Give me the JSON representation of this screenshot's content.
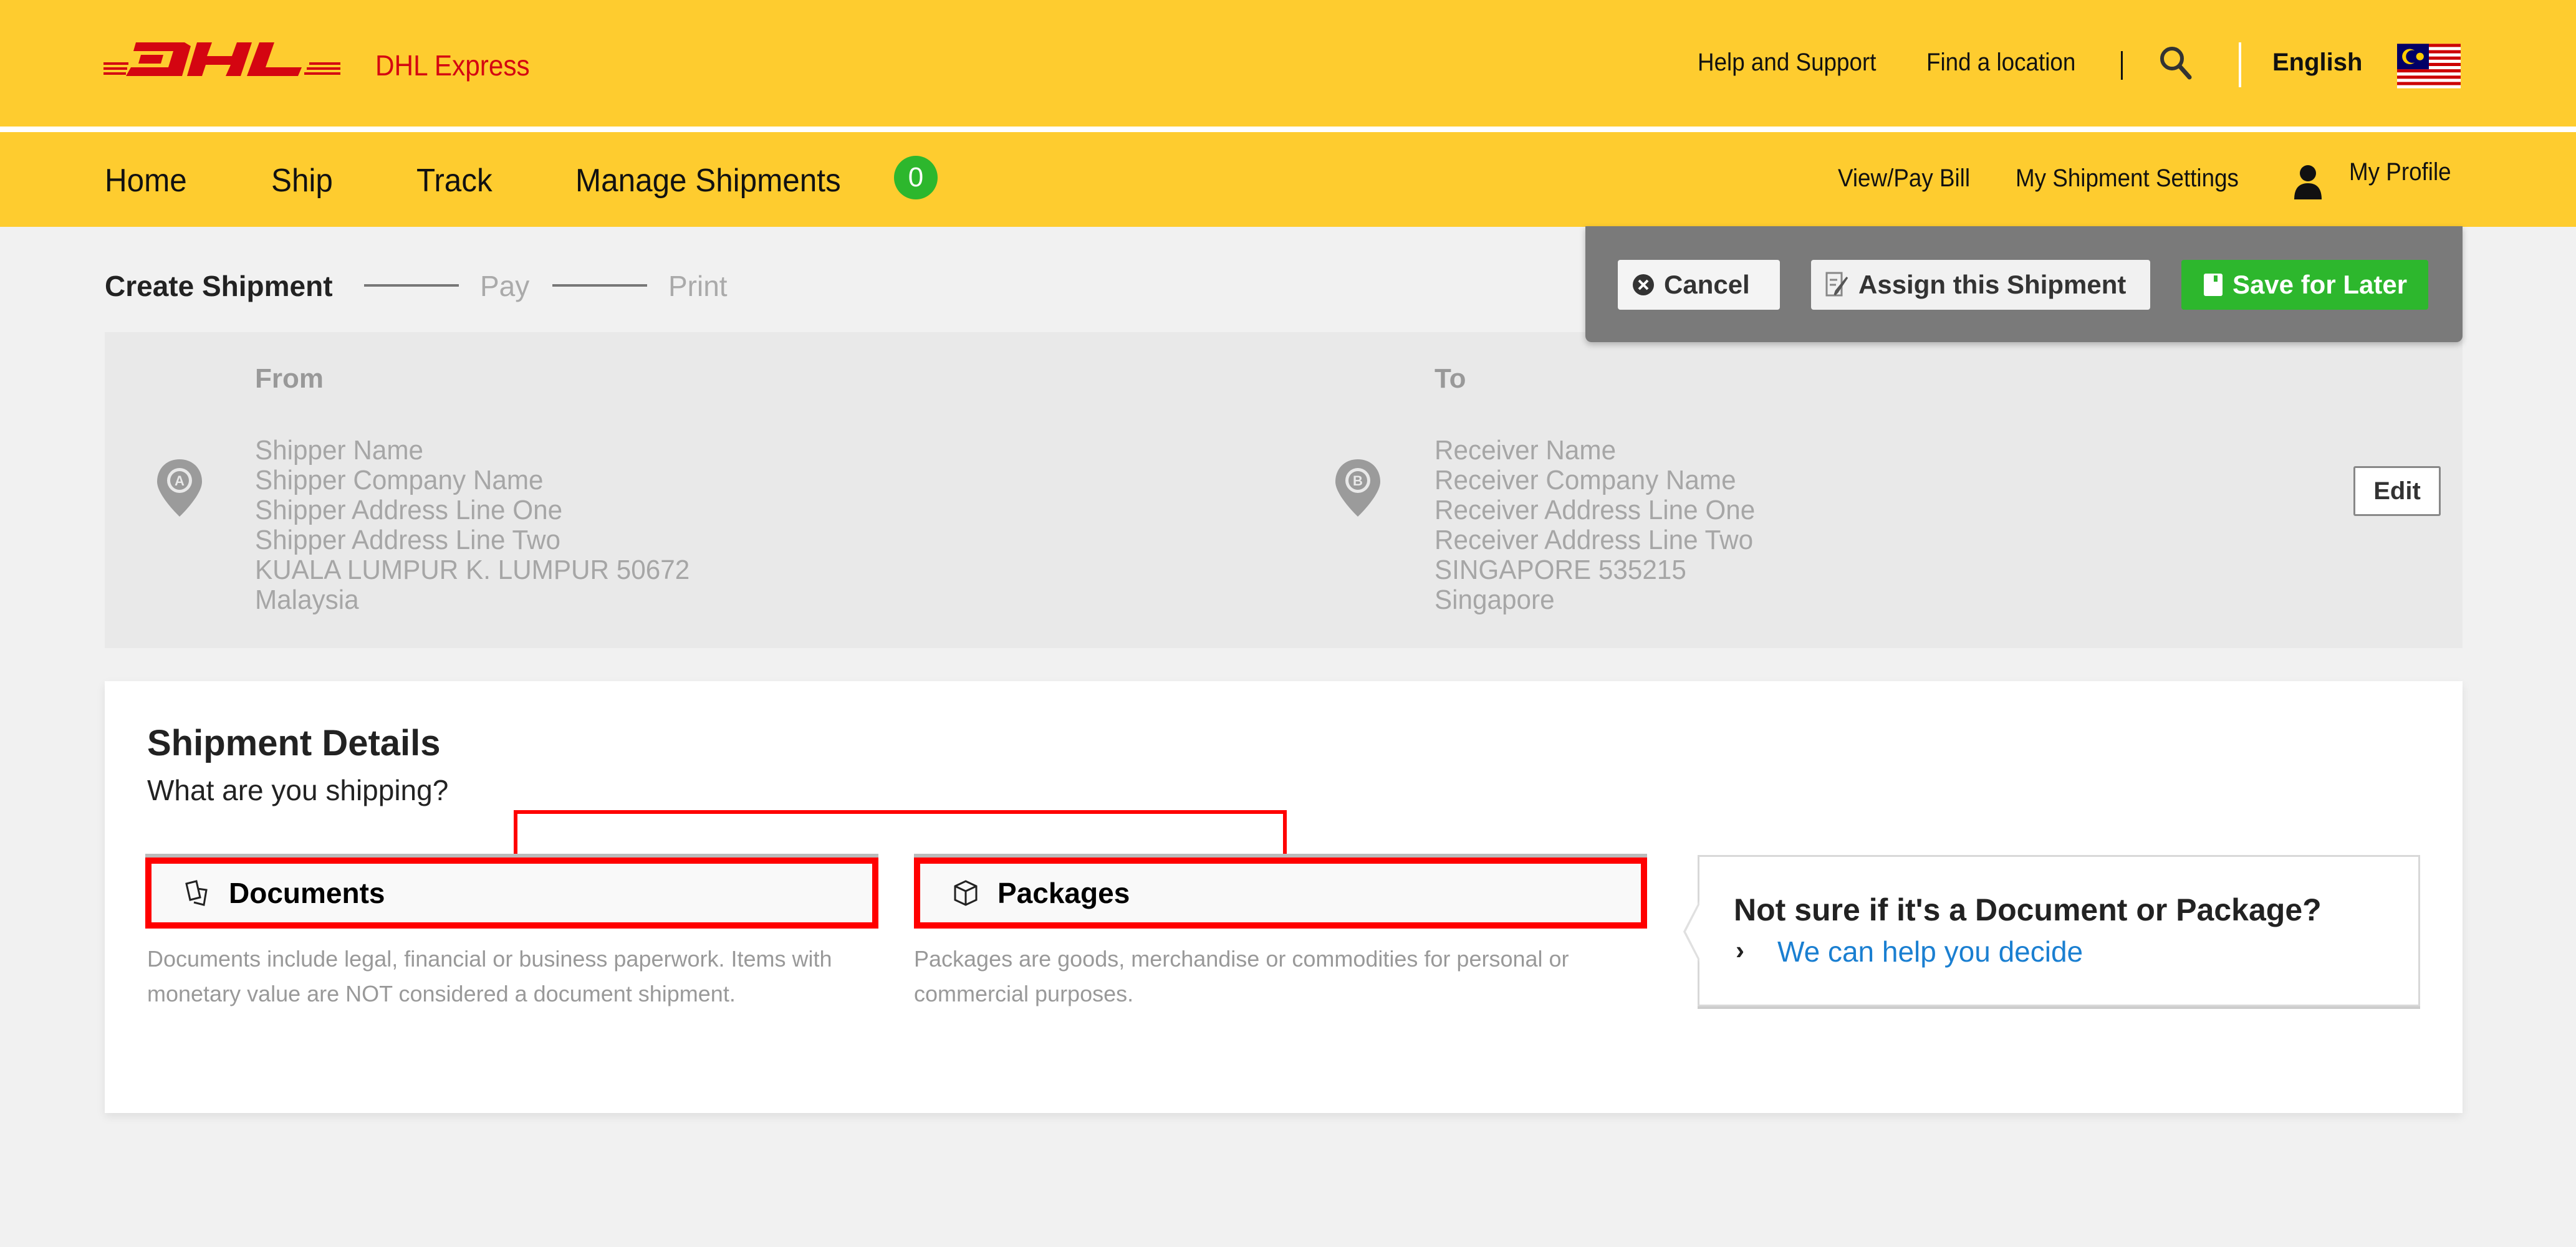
{
  "header": {
    "brand_name": "DHL Express",
    "logo_text": "DHL",
    "links": {
      "help": "Help and Support",
      "find_location": "Find a location"
    },
    "language": "English",
    "flag": "malaysia-flag",
    "icons": {
      "search": "search-icon"
    }
  },
  "nav": {
    "items": [
      {
        "label": "Home"
      },
      {
        "label": "Ship"
      },
      {
        "label": "Track"
      },
      {
        "label": "Manage Shipments"
      }
    ],
    "manage_badge_count": "0",
    "right": {
      "view_pay_bill": "View/Pay Bill",
      "shipment_settings": "My Shipment Settings",
      "profile": "My Profile"
    }
  },
  "steps": {
    "current": "Create Shipment",
    "pay": "Pay",
    "print": "Print"
  },
  "actions": {
    "cancel": "Cancel",
    "assign": "Assign this Shipment",
    "save": "Save for Later"
  },
  "addresses": {
    "from": {
      "label": "From",
      "pin": "A",
      "lines": [
        "Shipper Name",
        "Shipper Company Name",
        "Shipper Address Line One",
        "Shipper Address Line Two",
        "KUALA LUMPUR K. LUMPUR 50672",
        "Malaysia"
      ]
    },
    "to": {
      "label": "To",
      "pin": "B",
      "lines": [
        "Receiver Name",
        "Receiver Company Name",
        "Receiver Address Line One",
        "Receiver Address Line Two",
        "SINGAPORE 535215",
        "Singapore"
      ]
    },
    "edit_label": "Edit"
  },
  "shipment_details": {
    "title": "Shipment Details",
    "subtitle": "What are you shipping?",
    "documents": {
      "label": "Documents",
      "description": "Documents include legal, financial or business paperwork. Items with monetary value are NOT considered a document shipment."
    },
    "packages": {
      "label": "Packages",
      "description": "Packages are goods, merchandise or commodities for personal or commercial purposes."
    },
    "help": {
      "title": "Not sure if it's a Document or Package?",
      "link": "We can help you decide"
    }
  },
  "colors": {
    "brand_yellow": "#FECC2F",
    "brand_red": "#D40511",
    "success_green": "#2DB72D",
    "highlight_red": "#FF0000",
    "link_blue": "#1a7fd1"
  }
}
